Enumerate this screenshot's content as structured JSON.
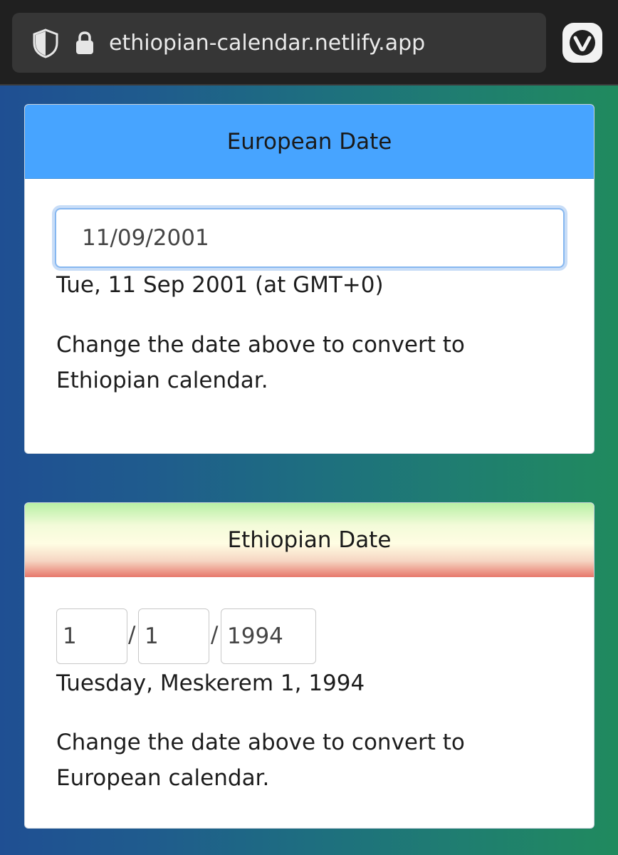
{
  "browser": {
    "url": "ethiopian-calendar.netlify.app"
  },
  "european_card": {
    "header": "European Date",
    "date_value": "11/09/2001",
    "result": "Tue, 11 Sep 2001 (at GMT+0)",
    "help": "Change the date above to convert to Ethiopian calendar."
  },
  "ethiopian_card": {
    "header": "Ethiopian Date",
    "day": "1",
    "month": "1",
    "year": "1994",
    "separator": "/",
    "result": "Tuesday, Meskerem 1, 1994",
    "help": "Change the date above to convert to European calendar."
  },
  "icons": {
    "shield": "shield-icon",
    "lock": "lock-icon",
    "browser_logo": "vivaldi-icon"
  },
  "colors": {
    "euro_header": "#47a4ff",
    "focus_ring": "#86b7f0",
    "background_left": "#1f4f93",
    "background_right": "#208a5e"
  }
}
